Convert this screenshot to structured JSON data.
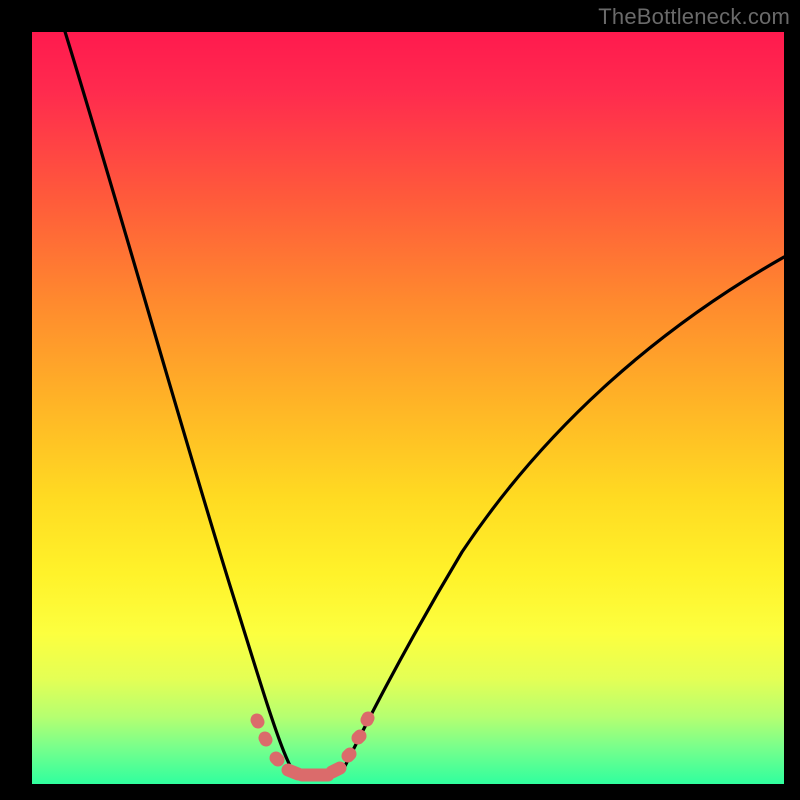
{
  "watermark": {
    "text": "TheBottleneck.com"
  },
  "chart_data": {
    "type": "line",
    "title": "",
    "xlabel": "",
    "ylabel": "",
    "xlim": [
      0,
      100
    ],
    "ylim": [
      0,
      100
    ],
    "gradient_stops": [
      {
        "pct": 0,
        "color": "#ff1a4e"
      },
      {
        "pct": 22,
        "color": "#ff5a3b"
      },
      {
        "pct": 50,
        "color": "#ffb626"
      },
      {
        "pct": 72,
        "color": "#fff22a"
      },
      {
        "pct": 91,
        "color": "#b6ff70"
      },
      {
        "pct": 100,
        "color": "#30ff9e"
      }
    ],
    "series": [
      {
        "name": "left-branch",
        "stroke": "#000000",
        "x": [
          4,
          6,
          8,
          10,
          12,
          14,
          16,
          18,
          20,
          22,
          24,
          26,
          28,
          30,
          32,
          33
        ],
        "y": [
          100,
          93,
          86,
          80,
          73,
          66,
          60,
          53,
          46,
          40,
          33,
          26,
          20,
          12,
          5,
          2
        ]
      },
      {
        "name": "right-branch",
        "stroke": "#000000",
        "x": [
          41,
          44,
          48,
          53,
          58,
          64,
          70,
          76,
          82,
          88,
          94,
          100
        ],
        "y": [
          2,
          6,
          12,
          19,
          26,
          33,
          40,
          46,
          52,
          58,
          64,
          70
        ]
      },
      {
        "name": "valley-floor",
        "stroke": "#e07070",
        "x": [
          29,
          30,
          31,
          32,
          33,
          34,
          35,
          36,
          37,
          38,
          39,
          40,
          41,
          42,
          43
        ],
        "y": [
          8,
          5,
          3,
          2,
          1.5,
          1,
          1,
          1,
          1,
          1.5,
          2,
          3,
          5,
          7,
          9
        ]
      }
    ],
    "annotations": []
  }
}
